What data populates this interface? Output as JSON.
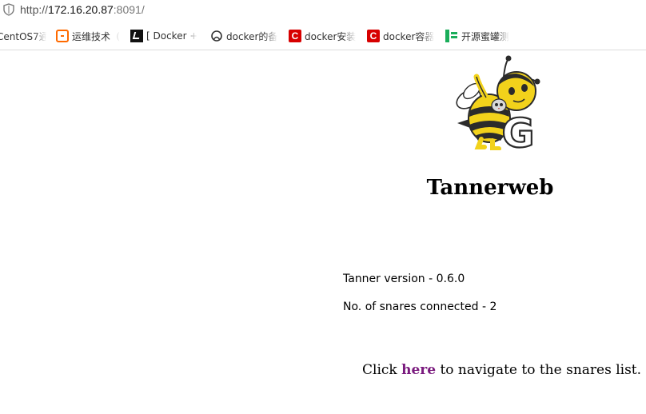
{
  "browser": {
    "url_prefix": "http://",
    "url_host": "172.16.20.87",
    "url_port": ":8091/",
    "bookmarks": [
      {
        "label": "CentOS7通",
        "icon": "none"
      },
      {
        "label": "运维技术（",
        "icon": "orange-bracket-icon"
      },
      {
        "label": "[ Docker +",
        "icon": "docker-bookmark-icon"
      },
      {
        "label": "docker的备",
        "icon": "github-icon"
      },
      {
        "label": "docker安装",
        "icon": "csdn-icon"
      },
      {
        "label": "docker容器",
        "icon": "csdn-icon"
      },
      {
        "label": "开源蜜罐测",
        "icon": "green-doc-icon"
      }
    ]
  },
  "page": {
    "title": "Tannerweb",
    "version_text": "Tanner version - 0.6.0",
    "snares_text": "No. of snares connected - 2",
    "nav_prefix": "Click ",
    "nav_link": "here",
    "nav_suffix": " to navigate to the snares list."
  },
  "colors": {
    "link": "#7a1a7e",
    "bee_yellow": "#f2d21b",
    "bee_black": "#2b2b2b"
  }
}
